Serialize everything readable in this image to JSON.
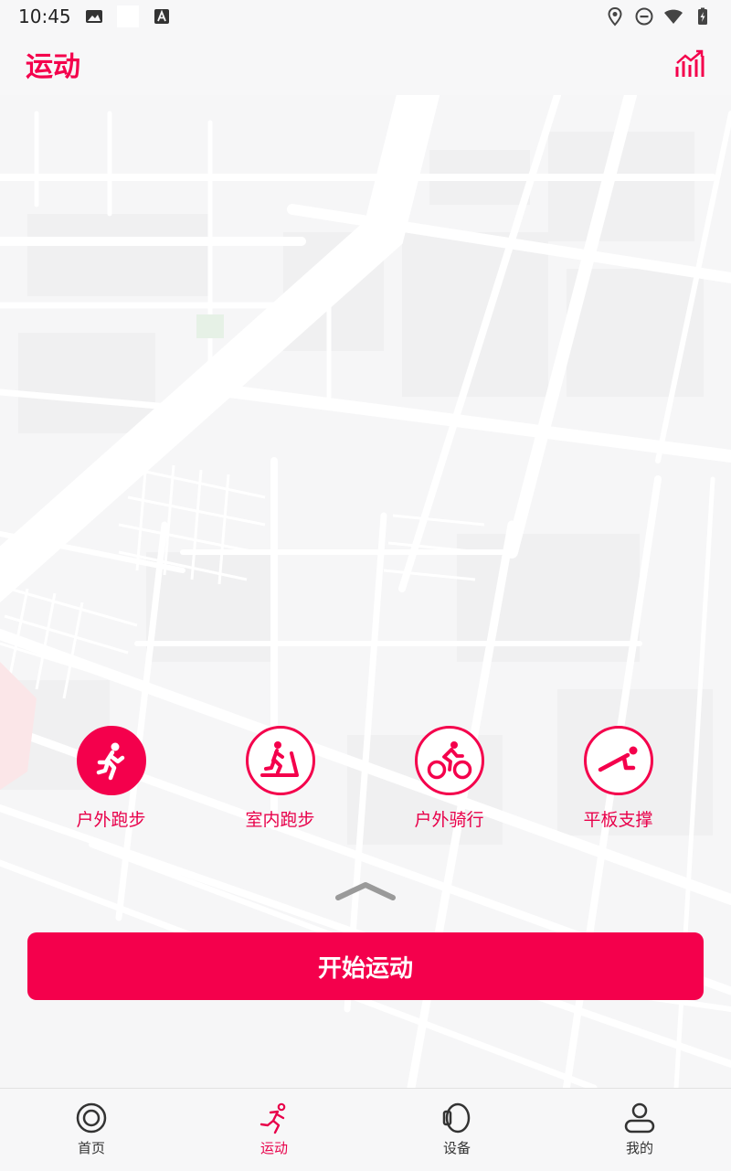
{
  "status_bar": {
    "time": "10:45"
  },
  "header": {
    "title": "运动"
  },
  "sports": [
    {
      "label": "户外跑步",
      "icon": "outdoor-run-icon",
      "selected": true
    },
    {
      "label": "室内跑步",
      "icon": "treadmill-icon",
      "selected": false
    },
    {
      "label": "户外骑行",
      "icon": "bicycle-icon",
      "selected": false
    },
    {
      "label": "平板支撑",
      "icon": "plank-icon",
      "selected": false
    }
  ],
  "start_button": {
    "label": "开始运动"
  },
  "tabs": [
    {
      "label": "首页",
      "icon": "home-target-icon",
      "active": false
    },
    {
      "label": "运动",
      "icon": "run-icon",
      "active": true
    },
    {
      "label": "设备",
      "icon": "watch-icon",
      "active": false
    },
    {
      "label": "我的",
      "icon": "profile-icon",
      "active": false
    }
  ],
  "colors": {
    "accent": "#f4004c",
    "background": "#f7f7f8",
    "map_road": "#ffffff",
    "map_block": "#f1f1f2"
  }
}
